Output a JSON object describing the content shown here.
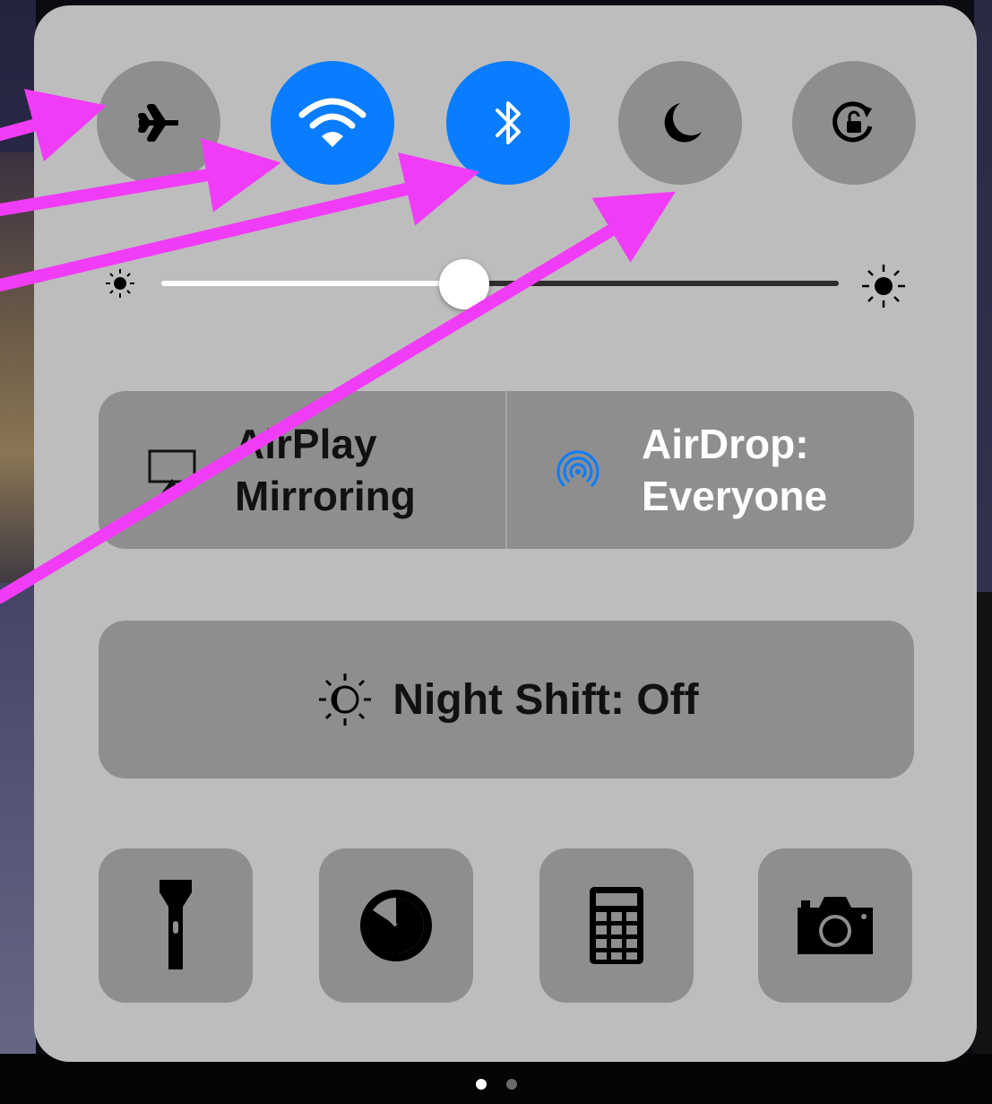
{
  "control_center": {
    "toggles": [
      {
        "id": "airplane",
        "icon": "airplane-icon",
        "active": false
      },
      {
        "id": "wifi",
        "icon": "wifi-icon",
        "active": true
      },
      {
        "id": "bluetooth",
        "icon": "bluetooth-icon",
        "active": true
      },
      {
        "id": "do_not_disturb",
        "icon": "moon-icon",
        "active": false
      },
      {
        "id": "rotation_lock",
        "icon": "rotation-lock-icon",
        "active": false
      }
    ],
    "brightness": {
      "level": 0.39
    },
    "airplay": {
      "line1": "AirPlay",
      "line2": "Mirroring",
      "icon": "airplay-icon"
    },
    "airdrop": {
      "line1": "AirDrop:",
      "line2": "Everyone",
      "icon": "airdrop-icon"
    },
    "night_shift": {
      "label": "Night Shift: Off",
      "icon": "night-shift-icon"
    },
    "shortcuts": [
      {
        "id": "flashlight",
        "icon": "flashlight-icon"
      },
      {
        "id": "timer",
        "icon": "timer-icon"
      },
      {
        "id": "calculator",
        "icon": "calculator-icon"
      },
      {
        "id": "camera",
        "icon": "camera-icon"
      }
    ],
    "page_indicator": {
      "pages": 2,
      "current": 1
    }
  },
  "colors": {
    "panel": "#bdbdbd",
    "button": "#8e8e8e",
    "active_blue": "#0a7cff",
    "annotation_arrow": "#f13cf7"
  },
  "annotation": {
    "arrow_count": 4
  }
}
